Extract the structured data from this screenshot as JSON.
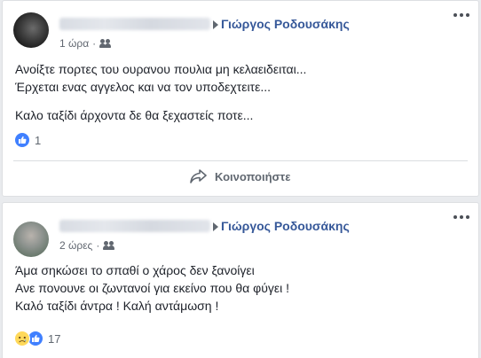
{
  "posts": [
    {
      "author": "Γιώργος Ροδουσάκης",
      "time": "1 ώρα",
      "separator": "·",
      "lines": [
        "Ανοίξτε πορτες του ουρανου πουλια μη κελαειδειται...",
        "Έρχεται ενας αγγελος και να τον υποδεχτειτε...",
        "Καλο ταξίδι άρχοντα δε θα ξεχαστείς ποτε..."
      ],
      "reaction_count": "1",
      "share_label": "Κοινοποιήστε"
    },
    {
      "author": "Γιώργος Ροδουσάκης",
      "time": "2 ώρες",
      "separator": "·",
      "lines": [
        "Άμα σηκώσει το σπαθί ο χάρος δεν ξανοίγει",
        "Ανε πονουνε οι ζωντανοί για εκείνο που θα φύγει !",
        "Καλό ταξίδι άντρα ! Καλή αντάμωση !"
      ],
      "reaction_count": "17"
    }
  ],
  "icons": {
    "audience": "friends-icon",
    "more": "more-options-icon",
    "like": "like-reaction-icon",
    "sad": "sad-reaction-icon",
    "share": "share-arrow-icon",
    "arrow": "caret-right-icon"
  },
  "colors": {
    "author_link": "#365899",
    "like_blue": "#4080ff",
    "sad_yellow": "#ffd95a",
    "page_bg": "#e9ebee"
  }
}
